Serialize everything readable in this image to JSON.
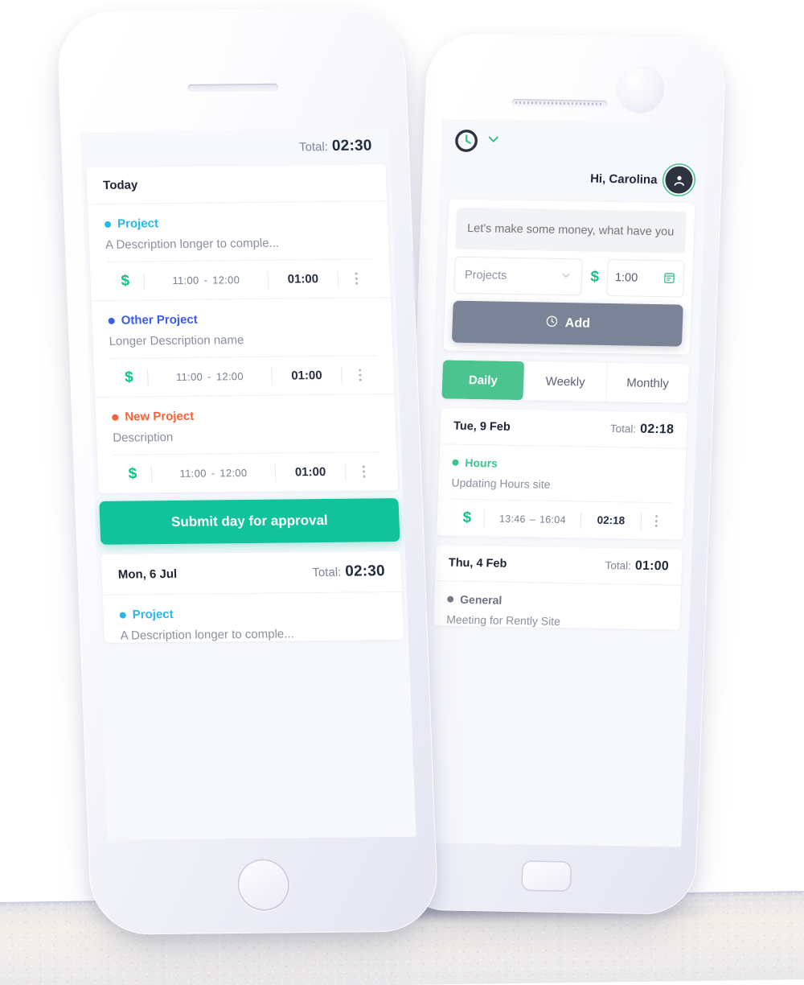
{
  "left_phone": {
    "header": {
      "total_label": "Total:",
      "total_value": "02:30"
    },
    "days": [
      {
        "day_label": "Today",
        "entries": [
          {
            "project": "Project",
            "color": "#29b6e8",
            "description": "A Description longer to comple...",
            "money_icon": "$",
            "start": "11:00",
            "dash": "-",
            "end": "12:00",
            "duration": "01:00"
          },
          {
            "project": "Other Project",
            "color": "#3a5cf0",
            "description": "Longer Description name",
            "money_icon": "$",
            "start": "11:00",
            "dash": "-",
            "end": "12:00",
            "duration": "01:00"
          },
          {
            "project": "New Project",
            "color": "#fa6238",
            "description": "Description",
            "money_icon": "$",
            "start": "11:00",
            "dash": "-",
            "end": "12:00",
            "duration": "01:00"
          }
        ]
      },
      {
        "day_label": "Mon, 6 Jul",
        "total_label": "Total:",
        "total_value": "02:30",
        "entries": [
          {
            "project": "Project",
            "color": "#29b6e8",
            "description": "A Description longer to comple..."
          }
        ]
      }
    ],
    "submit_button": "Submit day for approval"
  },
  "right_phone": {
    "header": {
      "greeting": "Hi, Carolina",
      "logo_icon": "clock-icon",
      "chevron_icon": "chevron-down-icon",
      "avatar_icon": "user-avatar-icon"
    },
    "compose": {
      "note_placeholder": "Let's make some money, what have you been doing?",
      "note_value": "",
      "project_select": "Projects",
      "money_icon": "$",
      "duration_value": "1:00",
      "calendar_icon": "calendar-icon",
      "add_label": "Add",
      "add_icon": "clock-icon"
    },
    "tabs": [
      {
        "label": "Daily",
        "active": true
      },
      {
        "label": "Weekly",
        "active": false
      },
      {
        "label": "Monthly",
        "active": false
      }
    ],
    "days": [
      {
        "day_label": "Tue, 9 Feb",
        "total_label": "Total:",
        "total_value": "02:18",
        "entries": [
          {
            "project": "Hours",
            "color": "#3cc48c",
            "description": "Updating Hours site",
            "money_icon": "$",
            "start": "13:46",
            "dash": "–",
            "end": "16:04",
            "duration": "02:18"
          }
        ]
      },
      {
        "day_label": "Thu, 4 Feb",
        "total_label": "Total:",
        "total_value": "01:00",
        "entries": [
          {
            "project": "General",
            "color": "#7a7a8c",
            "description": "Meeting for Rently Site"
          }
        ]
      }
    ]
  },
  "theme": {
    "green": "#11c29b",
    "tab_green": "#4bc490",
    "slate": "#7b8496",
    "money_green": "#11c08a"
  }
}
